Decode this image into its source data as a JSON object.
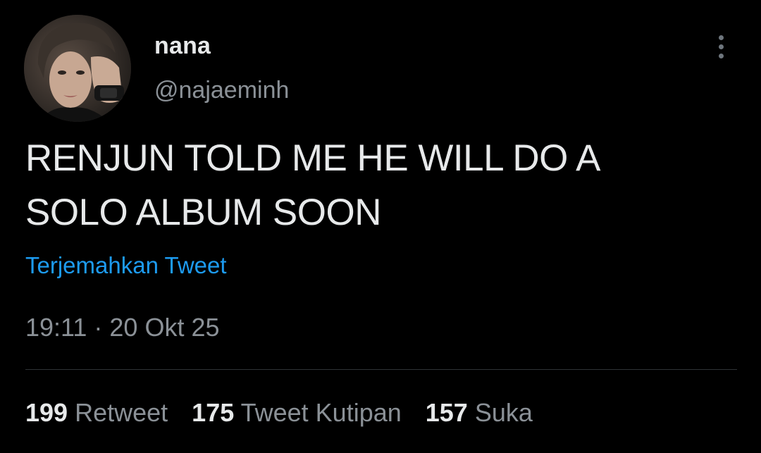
{
  "user": {
    "display_name": "nana",
    "handle": "@najaeminh"
  },
  "tweet": {
    "text_lines": [
      "RENJUN TOLD ME HE WILL DO A",
      "SOLO ALBUM SOON"
    ],
    "translate_label": "Terjemahkan Tweet",
    "timestamp": "19:11 · 20 Okt 25"
  },
  "stats": {
    "retweets": {
      "count": "199",
      "label": "Retweet"
    },
    "quotes": {
      "count": "175",
      "label": "Tweet Kutipan"
    },
    "likes": {
      "count": "157",
      "label": "Suka"
    }
  },
  "icons": {
    "more": "more-vertical-icon"
  },
  "colors": {
    "background": "#000000",
    "text": "#e7e9ea",
    "secondary": "#8b9197",
    "link": "#1d9bf0",
    "divider": "#2f3336"
  }
}
